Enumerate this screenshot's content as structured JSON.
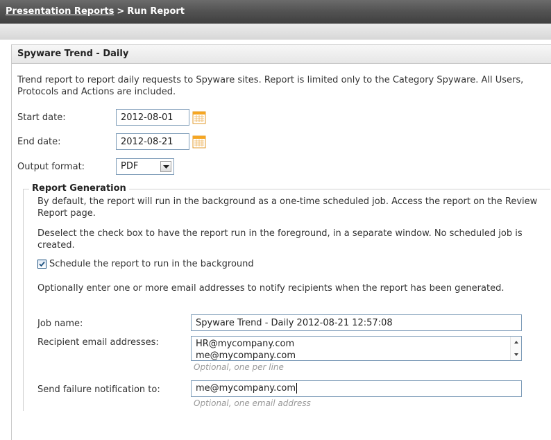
{
  "breadcrumb": {
    "parent": "Presentation Reports",
    "separator": ">",
    "current": "Run Report"
  },
  "report": {
    "title": "Spyware Trend - Daily",
    "description": "Trend report to report daily requests to Spyware sites. Report is limited only to the Category Spyware. All Users, Protocols and Actions are included."
  },
  "form": {
    "start_date_label": "Start date:",
    "start_date_value": "2012-08-01",
    "end_date_label": "End date:",
    "end_date_value": "2012-08-21",
    "output_format_label": "Output format:",
    "output_format_value": "PDF"
  },
  "generation": {
    "legend": "Report Generation",
    "para1": "By default, the report will run in the background as a one-time scheduled job. Access the report on the Review Report page.",
    "para2": "Deselect the check box to have the report run in the foreground, in a separate window. No scheduled job is created.",
    "checkbox_label": "Schedule the report to run in the background",
    "checkbox_checked": true,
    "para3": "Optionally enter one or more email addresses to notify recipients when the report has been generated.",
    "job_name_label": "Job name:",
    "job_name_value": "Spyware Trend - Daily 2012-08-21 12:57:08",
    "recipients_label": "Recipient email addresses:",
    "recipients": [
      "HR@mycompany.com",
      "me@mycompany.com"
    ],
    "recipients_hint": "Optional, one per line",
    "failure_label": "Send failure notification to:",
    "failure_value": "me@mycompany.com",
    "failure_hint": "Optional, one email address"
  },
  "icons": {
    "calendar": "calendar-icon",
    "dropdown": "chevron-down-icon",
    "checkbox": "checkmark-icon"
  },
  "colors": {
    "title_bar": "#4a4a4a",
    "input_border": "#7f9db9",
    "calendar_accent": "#f5a623",
    "hint_text": "#9a9a9a"
  }
}
